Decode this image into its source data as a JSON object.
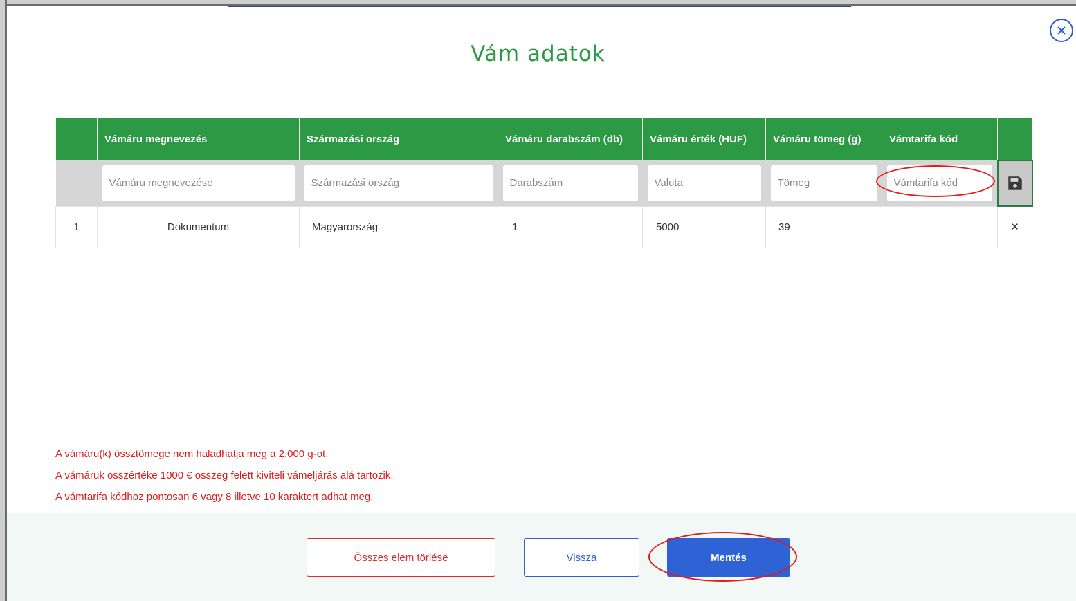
{
  "modal": {
    "title": "Vám adatok"
  },
  "table": {
    "headers": [
      "",
      "Vámáru megnevezés",
      "Származási ország",
      "Vámáru darabszám (db)",
      "Vámáru érték (HUF)",
      "Vámáru tömeg (g)",
      "Vámtarifa kód",
      ""
    ],
    "inputs": {
      "name_placeholder": "Vámáru megnevezése",
      "country_placeholder": "Származási ország",
      "count_placeholder": "Darabszám",
      "value_placeholder": "Valuta",
      "weight_placeholder": "Tömeg",
      "tariff_placeholder": "Vámtarifa kód"
    },
    "rows": [
      {
        "index": "1",
        "name": "Dokumentum",
        "country": "Magyarország",
        "count": "1",
        "value": "5000",
        "weight": "39",
        "tariff": ""
      }
    ]
  },
  "notes": [
    "A vámáru(k) össztömege nem haladhatja meg a 2.000 g-ot.",
    "A vámáruk összértéke 1000 € összeg felett kiviteli vámeljárás alá tartozik.",
    "A vámtarifa kódhoz pontosan 6 vagy 8 illetve 10 karaktert adhat meg."
  ],
  "footer": {
    "delete_all_label": "Összes elem törlése",
    "back_label": "Vissza",
    "save_label": "Mentés"
  },
  "icons": {
    "close": "close-circle-icon",
    "save": "floppy-disk-icon",
    "delete": "x-icon"
  },
  "colors": {
    "primary_green": "#2c9a44",
    "primary_blue": "#2f62d4",
    "danger_red": "#e11a1a"
  }
}
